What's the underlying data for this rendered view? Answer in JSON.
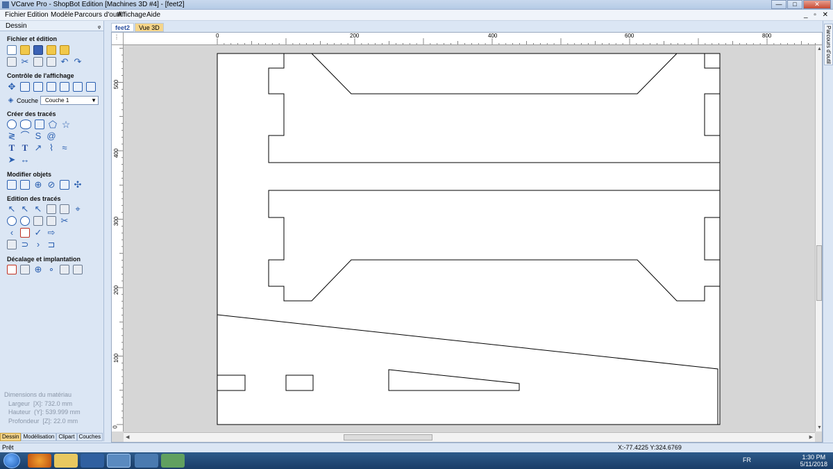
{
  "window": {
    "title": "VCarve Pro - ShopBot Edition [Machines 3D #4] - [feet2]",
    "buttons": [
      "minimize",
      "maximize",
      "close"
    ]
  },
  "menu": [
    "Fichier",
    "Edition",
    "Modèle",
    "Parcours d'outil",
    "Affichage",
    "Aide"
  ],
  "left_panel": {
    "header": "Dessin",
    "sections": {
      "file": "Fichier et édition",
      "view": "Contrôle de l'affichage",
      "create": "Créer des tracés",
      "modify": "Modifier objets",
      "edit": "Edition des tracés",
      "offset": "Décalage et implantation"
    },
    "layer_label": "Couche",
    "layer_value": "Couche 1",
    "material": {
      "title": "Dimensions du matériau",
      "width_label": "Largeur",
      "width_axis": "[X]:",
      "width_value": "732.0 mm",
      "height_label": "Hauteur",
      "height_axis": "(Y]:",
      "height_value": "539.999 mm",
      "depth_label": "Profondeur",
      "depth_axis": "[Z]:",
      "depth_value": "22.0 mm"
    },
    "tabs": [
      "Dessin",
      "Modélisation",
      "Clipart",
      "Couches"
    ]
  },
  "doc_tabs": [
    "feet2",
    "Vue 3D"
  ],
  "rulers": {
    "h_labels": [
      "0",
      "200",
      "400",
      "600",
      "800"
    ],
    "v_labels": [
      "500",
      "400",
      "300",
      "200",
      "100",
      "0"
    ]
  },
  "right_bar": {
    "label": "Parcours d'outil"
  },
  "status": {
    "ready": "Prêt",
    "coords": "X:-77.4225 Y:324.6769"
  },
  "taskbar": {
    "lang": "FR",
    "time": "1:30 PM",
    "date": "5/11/2018"
  }
}
